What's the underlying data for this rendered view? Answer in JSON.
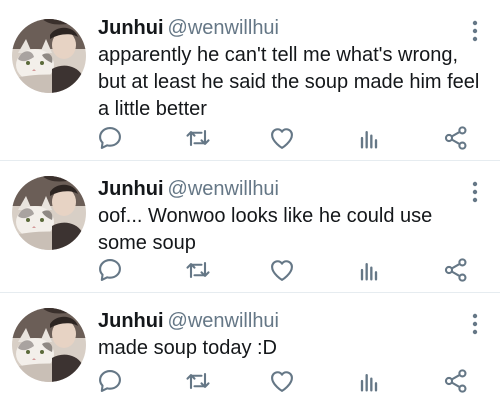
{
  "tweets": [
    {
      "name": "Junhui",
      "handle": "@wenwillhui",
      "text": "apparently he can't tell me what's wrong, but at least he said the soup made him feel a little better"
    },
    {
      "name": "Junhui",
      "handle": "@wenwillhui",
      "text": "oof... Wonwoo looks like he could use some soup"
    },
    {
      "name": "Junhui",
      "handle": "@wenwillhui",
      "text": "made soup today :D"
    }
  ],
  "icons": {
    "reply": "reply-icon",
    "retweet": "retweet-icon",
    "like": "heart-icon",
    "analytics": "analytics-icon",
    "share": "share-icon",
    "more": "more-options-icon"
  },
  "colors": {
    "text": "#14171a",
    "secondary": "#657786",
    "icon": "#657786",
    "divider": "#e6ecf0"
  }
}
